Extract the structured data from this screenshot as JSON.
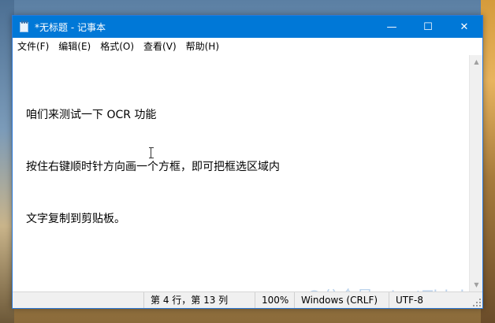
{
  "window": {
    "title": "*无标题 - 记事本",
    "controls": {
      "minimize": "—",
      "maximize": "☐",
      "close": "✕"
    }
  },
  "menu": [
    {
      "label": "文件(F)"
    },
    {
      "label": "编辑(E)"
    },
    {
      "label": "格式(O)"
    },
    {
      "label": "查看(V)"
    },
    {
      "label": "帮助(H)"
    }
  ],
  "editor": {
    "lines": [
      "咱们来测试一下 OCR 功能",
      "按住右键顺时针方向画一个方框，即可把框选区域内",
      "文字复制到剪贴板。"
    ]
  },
  "status": {
    "position": "第 4 行，第 13 列",
    "zoom": "100%",
    "line_ending": "Windows (CRLF)",
    "encoding": "UTF-8"
  },
  "watermark": "@公众号：JustThink",
  "colors": {
    "titlebar": "#0078d7",
    "statusbar": "#f0f0f0"
  },
  "icons": [
    "notepad-icon",
    "minimize-icon",
    "maximize-icon",
    "close-icon",
    "text-cursor-icon",
    "resize-grip-icon"
  ]
}
